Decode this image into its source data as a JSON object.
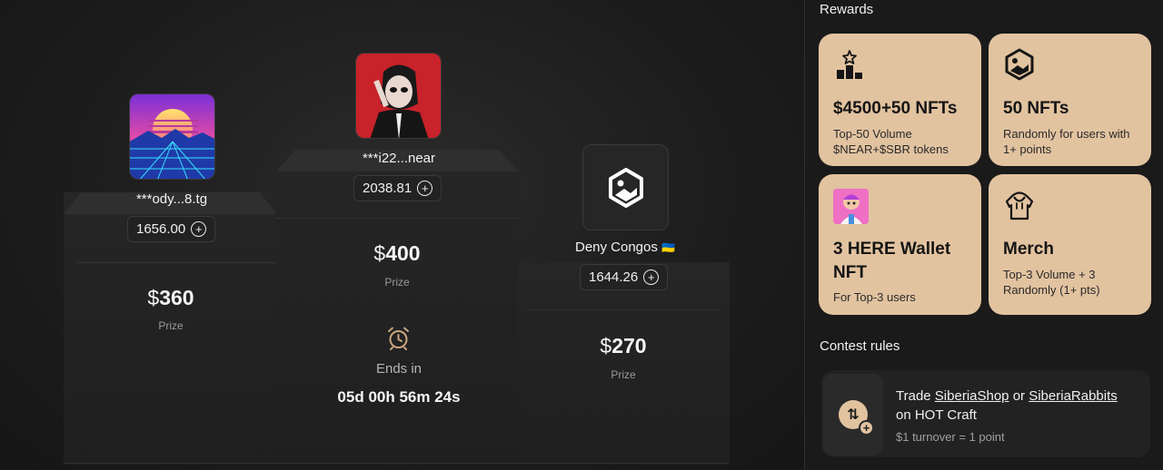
{
  "podium": {
    "second": {
      "username": "***ody...8.tg",
      "score": "1656.00",
      "prize": "360",
      "prize_label": "Prize"
    },
    "first": {
      "username": "***i22...near",
      "score": "2038.81",
      "prize": "400",
      "prize_label": "Prize",
      "ends_label": "Ends in",
      "timer": "05d 00h 56m 24s"
    },
    "third": {
      "username": "Deny Congos",
      "flag": "🇺🇦",
      "score": "1644.26",
      "prize": "270",
      "prize_label": "Prize"
    },
    "currency_symbol": "$"
  },
  "sidebar": {
    "rewards_title": "Rewards",
    "cards": [
      {
        "icon": "podium-star-icon",
        "title": "$4500+50 NFTs",
        "subtitle": "Top-50 Volume $NEAR+$SBR tokens"
      },
      {
        "icon": "nft-image-icon",
        "title": "50 NFTs",
        "subtitle": "Randomly for users with 1+ points"
      },
      {
        "icon": "wallet-nft-avatar",
        "title": "3 HERE Wallet NFT",
        "subtitle": "For Top-3 users"
      },
      {
        "icon": "merch-hoodie-icon",
        "title": "Merch",
        "subtitle": "Top-3 Volume + 3 Randomly (1+ pts)"
      }
    ],
    "rules_title": "Contest rules",
    "rule": {
      "prefix": "Trade ",
      "link1": "SiberiaShop",
      "middle": " or ",
      "link2": "SiberiaRabbits",
      "suffix": "on HOT Craft",
      "note": "$1 turnover = 1 point"
    }
  },
  "colors": {
    "card_bg": "#e2c3a0",
    "page_bg": "#1b1b1b"
  }
}
